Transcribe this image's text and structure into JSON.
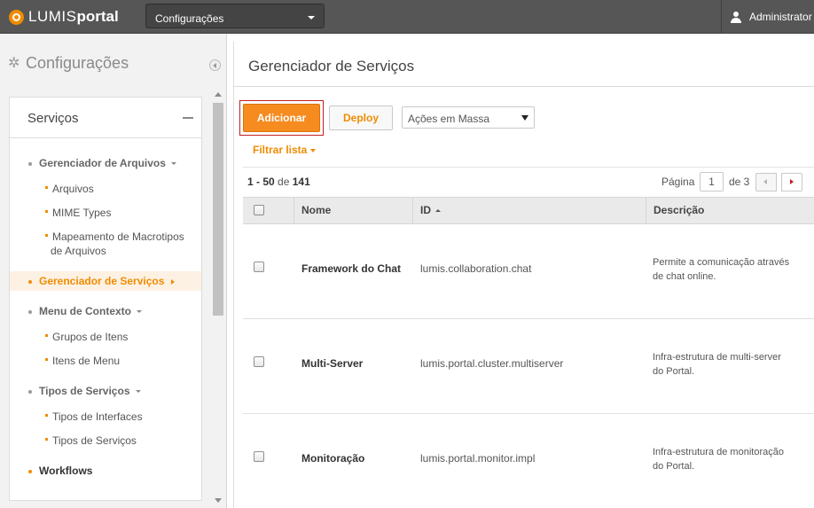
{
  "topbar": {
    "logo_part1": "LUMIS",
    "logo_part2": "portal",
    "context_select": "Configurações",
    "user_name": "Administrator"
  },
  "left": {
    "title": "Configurações",
    "nav_header": "Serviços",
    "items": [
      {
        "label": "Gerenciador de Arquivos",
        "level": 1
      },
      {
        "label": "Arquivos",
        "level": 2
      },
      {
        "label": "MIME Types",
        "level": 2
      },
      {
        "label": "Mapeamento de Macrotipos de Arquivos",
        "line1": "Mapeamento de Macrotipos",
        "line2": "de Arquivos",
        "level": 2
      },
      {
        "label": "Gerenciador de Serviços",
        "level": 1,
        "active": true
      },
      {
        "label": "Menu de Contexto",
        "level": 1
      },
      {
        "label": "Grupos de Itens",
        "level": 2
      },
      {
        "label": "Itens de Menu",
        "level": 2
      },
      {
        "label": "Tipos de Serviços",
        "level": 1
      },
      {
        "label": "Tipos de Interfaces",
        "level": 2
      },
      {
        "label": "Tipos de Serviços",
        "level": 2
      },
      {
        "label": "Workflows",
        "level": 1
      }
    ]
  },
  "main": {
    "title": "Gerenciador de Serviços",
    "add_button": "Adicionar",
    "deploy_button": "Deploy",
    "bulk_actions": "Ações em Massa",
    "filter_link": "Filtrar lista",
    "count_range": "1 - 50",
    "count_of": "de",
    "count_total": "141",
    "page_label": "Página",
    "page_value": "1",
    "page_of": "de 3",
    "columns": {
      "name": "Nome",
      "id": "ID",
      "description": "Descrição"
    },
    "rows": [
      {
        "name": "Framework do Chat",
        "id": "lumis.collaboration.chat",
        "desc_line1": "Permite a comunicação através",
        "desc_line2": "de chat online."
      },
      {
        "name": "Multi-Server",
        "id": "lumis.portal.cluster.multiserver",
        "desc_line1": "Infra-estrutura de multi-server",
        "desc_line2": "do Portal."
      },
      {
        "name": "Monitoração",
        "id": "lumis.portal.monitor.impl",
        "desc_line1": "Infra-estrutura de monitoração",
        "desc_line2": "do Portal."
      }
    ]
  },
  "colors": {
    "accent": "#f08c00",
    "topbar": "#565656",
    "highlight_border": "#c41e1e"
  }
}
